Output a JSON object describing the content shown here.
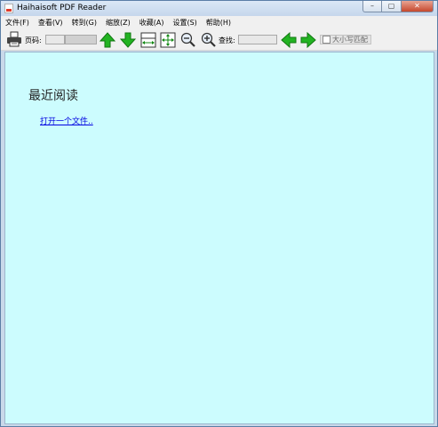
{
  "window": {
    "title": "Haihaisoft PDF Reader"
  },
  "menu": {
    "items": [
      {
        "label": "文件(F)"
      },
      {
        "label": "查看(V)"
      },
      {
        "label": "转到(G)"
      },
      {
        "label": "缩放(Z)"
      },
      {
        "label": "收藏(A)"
      },
      {
        "label": "设置(S)"
      },
      {
        "label": "帮助(H)"
      }
    ]
  },
  "toolbar": {
    "page_label": "页码:",
    "page_value": "",
    "find_label": "查找:",
    "find_value": "",
    "match_case_label": "大小写匹配",
    "match_case_checked": false
  },
  "content": {
    "recent_title": "最近阅读",
    "open_file_link": "打开一个文件.."
  },
  "colors": {
    "content_background": "#ccfcfe",
    "arrow_green": "#22b322",
    "link": "#0000e0"
  },
  "icons": [
    "print-icon",
    "page-up-icon",
    "page-down-icon",
    "fit-width-icon",
    "fit-page-icon",
    "zoom-out-icon",
    "zoom-in-icon",
    "find-previous-icon",
    "find-next-icon"
  ]
}
